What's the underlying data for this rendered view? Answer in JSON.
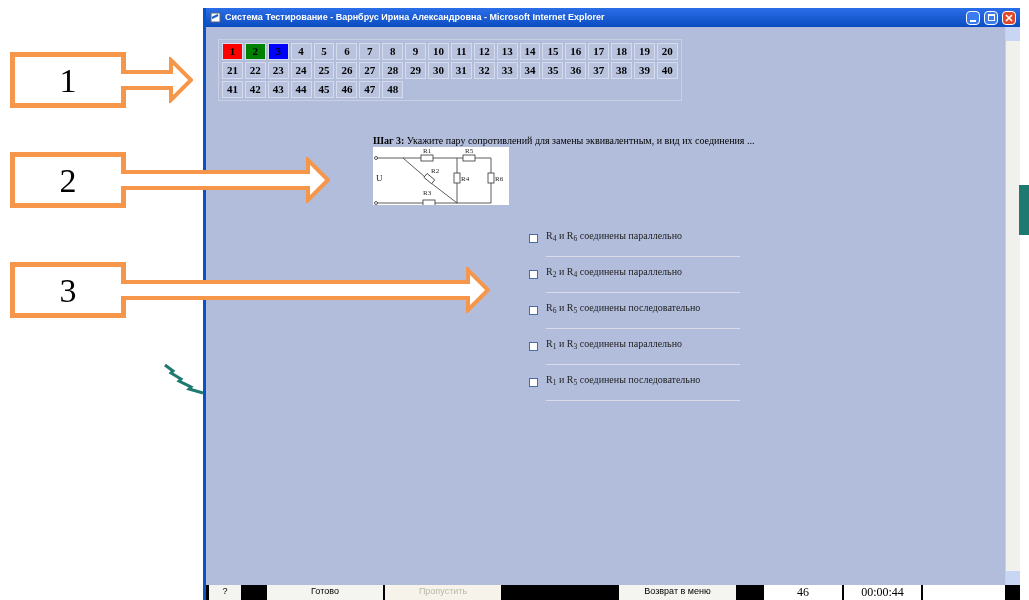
{
  "window": {
    "title": "Система Тестирование - Варнбрус Ирина Александровна - Microsoft Internet Explorer"
  },
  "question_nav": {
    "items": [
      {
        "label": "1",
        "color": "#ff0000"
      },
      {
        "label": "2",
        "color": "#008000"
      },
      {
        "label": "3",
        "color": "#0000ff"
      },
      {
        "label": "4",
        "color": "#b9c3de"
      },
      {
        "label": "5",
        "color": "#b9c3de"
      },
      {
        "label": "6",
        "color": "#b9c3de"
      },
      {
        "label": "7",
        "color": "#b9c3de"
      },
      {
        "label": "8",
        "color": "#b9c3de"
      },
      {
        "label": "9",
        "color": "#b9c3de"
      },
      {
        "label": "10",
        "color": "#b9c3de"
      },
      {
        "label": "11",
        "color": "#b9c3de"
      },
      {
        "label": "12",
        "color": "#b9c3de"
      },
      {
        "label": "13",
        "color": "#b9c3de"
      },
      {
        "label": "14",
        "color": "#b9c3de"
      },
      {
        "label": "15",
        "color": "#b9c3de"
      },
      {
        "label": "16",
        "color": "#b9c3de"
      },
      {
        "label": "17",
        "color": "#b9c3de"
      },
      {
        "label": "18",
        "color": "#b9c3de"
      },
      {
        "label": "19",
        "color": "#b9c3de"
      },
      {
        "label": "20",
        "color": "#b9c3de"
      },
      {
        "label": "21",
        "color": "#b9c3de"
      },
      {
        "label": "22",
        "color": "#b9c3de"
      },
      {
        "label": "23",
        "color": "#b9c3de"
      },
      {
        "label": "24",
        "color": "#b9c3de"
      },
      {
        "label": "25",
        "color": "#b9c3de"
      },
      {
        "label": "26",
        "color": "#b9c3de"
      },
      {
        "label": "27",
        "color": "#b9c3de"
      },
      {
        "label": "28",
        "color": "#b9c3de"
      },
      {
        "label": "29",
        "color": "#b9c3de"
      },
      {
        "label": "30",
        "color": "#b9c3de"
      },
      {
        "label": "31",
        "color": "#b9c3de"
      },
      {
        "label": "32",
        "color": "#b9c3de"
      },
      {
        "label": "33",
        "color": "#b9c3de"
      },
      {
        "label": "34",
        "color": "#b9c3de"
      },
      {
        "label": "35",
        "color": "#b9c3de"
      },
      {
        "label": "36",
        "color": "#b9c3de"
      },
      {
        "label": "37",
        "color": "#b9c3de"
      },
      {
        "label": "38",
        "color": "#b9c3de"
      },
      {
        "label": "39",
        "color": "#b9c3de"
      },
      {
        "label": "40",
        "color": "#b9c3de"
      },
      {
        "label": "41",
        "color": "#b9c3de"
      },
      {
        "label": "42",
        "color": "#b9c3de"
      },
      {
        "label": "43",
        "color": "#b9c3de"
      },
      {
        "label": "44",
        "color": "#b9c3de"
      },
      {
        "label": "45",
        "color": "#b9c3de"
      },
      {
        "label": "46",
        "color": "#b9c3de"
      },
      {
        "label": "47",
        "color": "#b9c3de"
      },
      {
        "label": "48",
        "color": "#b9c3de"
      }
    ]
  },
  "question": {
    "text": "**Шаг 3:** Укажите пару сопротивлений для замены эквивалентным, и вид их соединения ...",
    "circuit_labels": [
      "U",
      "R1",
      "R2",
      "R3",
      "R4",
      "R5",
      "R6"
    ]
  },
  "options": [
    {
      "text": "R$_{4}$ и R$_{6}$ соединены параллельно",
      "checked": false
    },
    {
      "text": "R$_{2}$ и R$_{4}$ соединены параллельно",
      "checked": false
    },
    {
      "text": "R$_{6}$ и R$_{5}$ соединены последовательно",
      "checked": false
    },
    {
      "text": "R$_{1}$ и R$_{3}$ соединены параллельно",
      "checked": false
    },
    {
      "text": "R$_{1}$ и R$_{5}$ соединены последовательно",
      "checked": false
    }
  ],
  "bottom_bar": [
    {
      "kind": "button",
      "label": "?",
      "disabled": false
    },
    {
      "kind": "gap"
    },
    {
      "kind": "button",
      "label": "Готово",
      "disabled": false
    },
    {
      "kind": "button",
      "label": "Пропустить",
      "disabled": true
    },
    {
      "kind": "gap"
    },
    {
      "kind": "button",
      "label": "Возврат в меню",
      "disabled": false
    },
    {
      "kind": "gap"
    },
    {
      "kind": "readout",
      "label": "46"
    },
    {
      "kind": "readout",
      "label": "00:00:44"
    }
  ],
  "callouts": [
    {
      "label": "1"
    },
    {
      "label": "2"
    },
    {
      "label": "3"
    }
  ]
}
